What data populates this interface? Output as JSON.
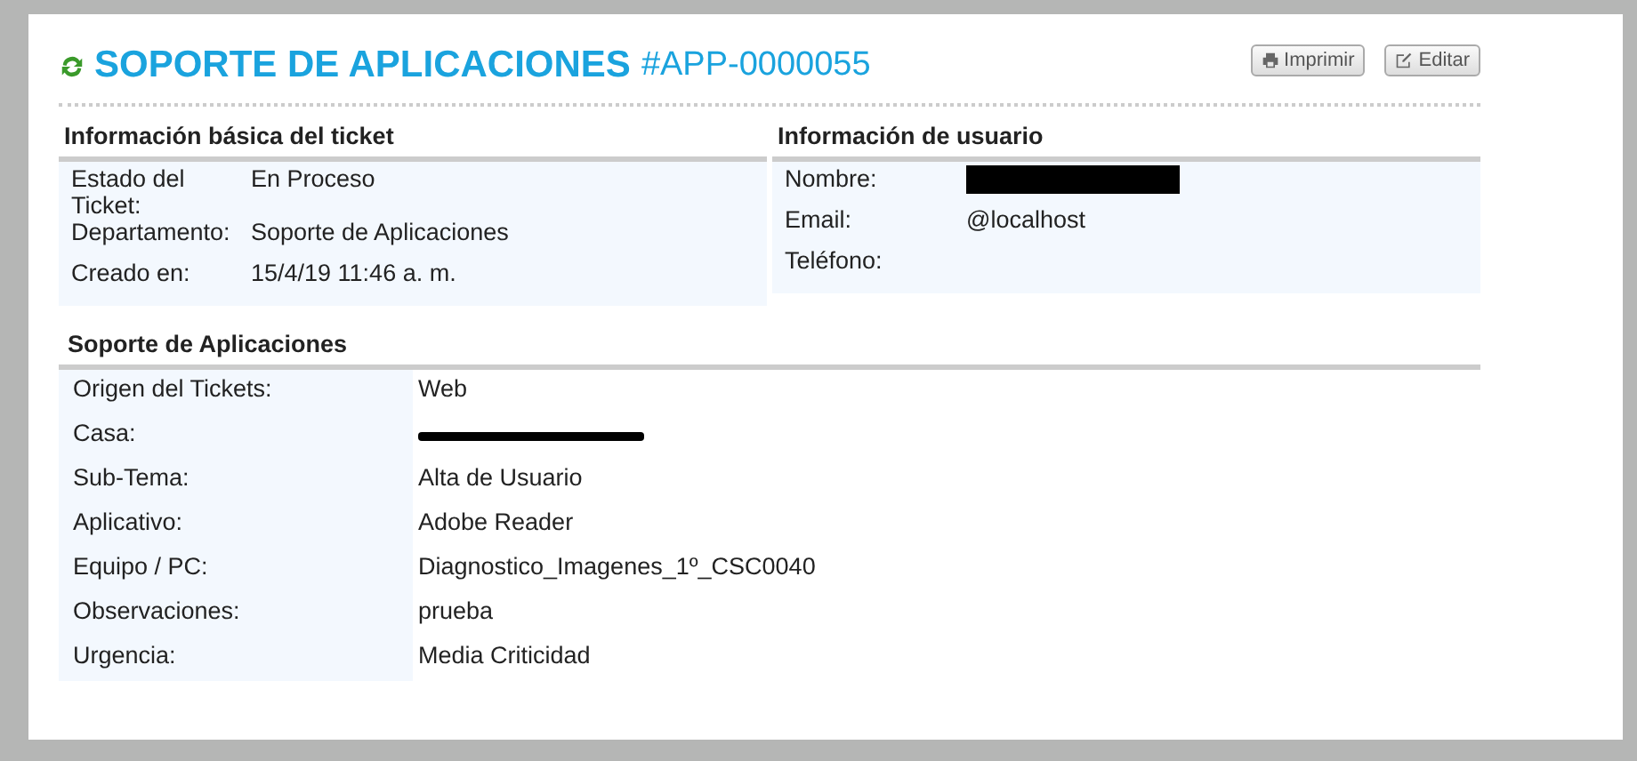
{
  "header": {
    "title": "SOPORTE DE APLICACIONES",
    "ticket_number": "#APP-0000055",
    "buttons": [
      "Imprimir",
      "Editar"
    ]
  },
  "basic_info": {
    "title": "Información básica del ticket",
    "rows": [
      {
        "label": "Estado del Ticket:",
        "value": "En Proceso"
      },
      {
        "label": "Departamento:",
        "value": "Soporte de Aplicaciones"
      },
      {
        "label": "Creado en:",
        "value": "15/4/19 11:46 a. m."
      }
    ]
  },
  "user_info": {
    "title": "Información de usuario",
    "rows": [
      {
        "label": "Nombre:",
        "kind": "redacted"
      },
      {
        "label": "Email:",
        "value": "@localhost"
      },
      {
        "label": "Teléfono:"
      }
    ]
  },
  "details": {
    "title": "Soporte de Aplicaciones",
    "rows": [
      {
        "label": "Origen del Tickets:",
        "value": "Web"
      },
      {
        "label": "Casa:",
        "kind": "redacted"
      },
      {
        "label": "Sub-Tema:",
        "value": "Alta de Usuario"
      },
      {
        "label": "Aplicativo:",
        "value": "Adobe Reader"
      },
      {
        "label": "Equipo / PC:",
        "value": "Diagnostico_Imagenes_1º_CSC0040"
      },
      {
        "label": "Observaciones:",
        "value": "prueba"
      },
      {
        "label": "Urgencia:",
        "value": "Media Criticidad"
      }
    ]
  }
}
